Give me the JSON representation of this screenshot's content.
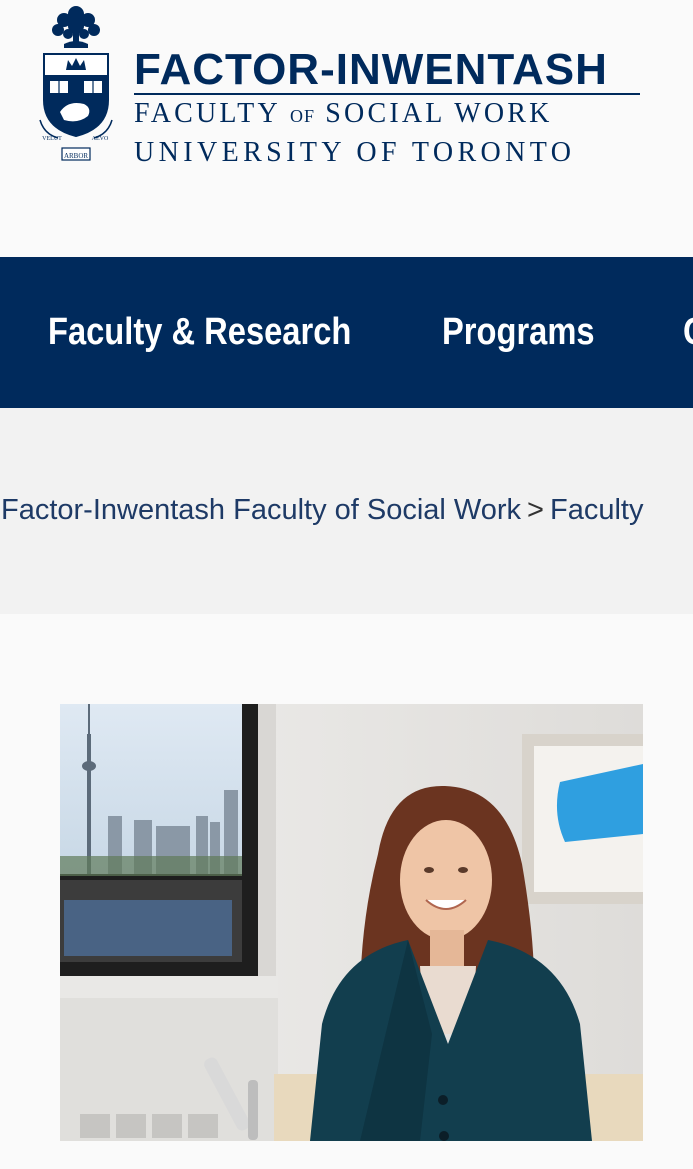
{
  "logo": {
    "line1": "FACTOR-INWENTASH",
    "line2_part1": "FACULTY",
    "line2_of": "OF",
    "line2_part2": "SOCIAL WORK",
    "line3": "UNIVERSITY OF TORONTO",
    "crest_motto_left": "VELUT",
    "crest_motto_right": "AEVO",
    "crest_motto_bottom": "ARBOR",
    "icon": "university-crest-icon"
  },
  "nav": {
    "items": [
      {
        "label": "Faculty & Research"
      },
      {
        "label": "Programs"
      },
      {
        "label": "C"
      }
    ]
  },
  "breadcrumb": {
    "items": [
      {
        "label": "Factor-Inwentash Faculty of Social Work"
      },
      {
        "label": "Faculty"
      }
    ],
    "separator": ">"
  },
  "colors": {
    "brand_navy": "#002a5c",
    "band_gray": "#f2f2f2",
    "page_bg": "#fafafa"
  }
}
